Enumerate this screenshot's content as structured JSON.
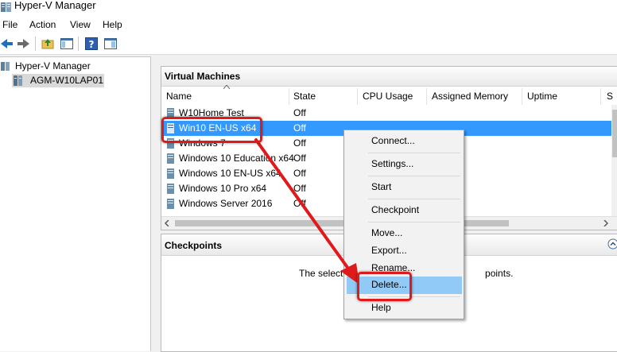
{
  "window": {
    "title": "Hyper-V Manager"
  },
  "menu": [
    "File",
    "Action",
    "View",
    "Help"
  ],
  "tree": {
    "root": "Hyper-V Manager",
    "server": "AGM-W10LAP01"
  },
  "vm_panel": {
    "title": "Virtual Machines",
    "columns": [
      "Name",
      "State",
      "CPU Usage",
      "Assigned Memory",
      "Uptime",
      "S"
    ],
    "rows": [
      {
        "name": "W10Home Test",
        "state": "Off"
      },
      {
        "name": "Win10 EN-US x64",
        "state": "Off"
      },
      {
        "name": "Windows 7",
        "state": "Off"
      },
      {
        "name": "Windows 10 Education x64",
        "state": "Off"
      },
      {
        "name": "Windows 10 EN-US x64",
        "state": "Off"
      },
      {
        "name": "Windows 10 Pro x64",
        "state": "Off"
      },
      {
        "name": "Windows Server 2016",
        "state": "Off"
      }
    ]
  },
  "checkpoints": {
    "title": "Checkpoints",
    "message_start": "The selecte",
    "message_end": "points."
  },
  "context_menu": [
    "Connect...",
    "Settings...",
    "Start",
    "Checkpoint",
    "Move...",
    "Export...",
    "Rename...",
    "Delete...",
    "Help"
  ],
  "colors": {
    "selection": "#3399ff",
    "menu_highlight": "#91c9f7",
    "annotation": "#e01a1a"
  }
}
